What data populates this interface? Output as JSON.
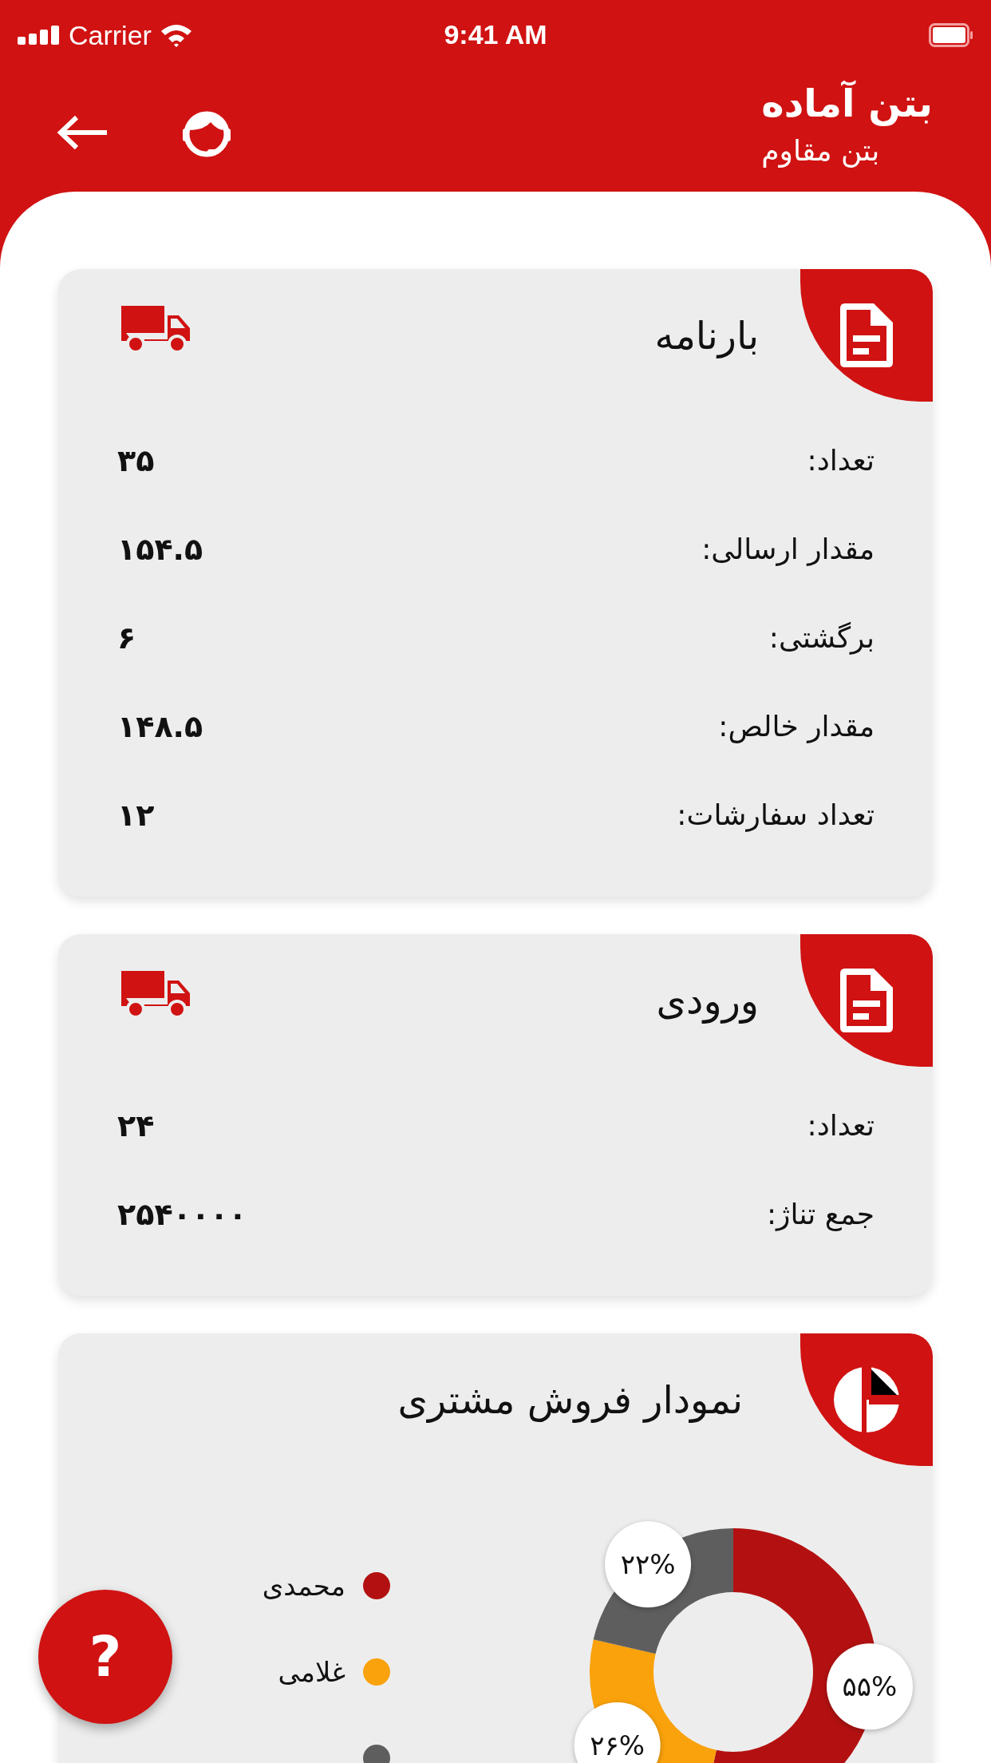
{
  "status_bar": {
    "carrier": "Carrier",
    "time": "9:41 AM"
  },
  "header": {
    "title": "بتن آماده",
    "subtitle": "بتن مقاوم"
  },
  "cards": [
    {
      "title": "بارنامه",
      "rows": [
        {
          "label": "تعداد:",
          "value": "۳۵"
        },
        {
          "label": "مقدار ارسالی:",
          "value": "۱۵۴.۵"
        },
        {
          "label": "برگشتی:",
          "value": "۶"
        },
        {
          "label": "مقدار خالص:",
          "value": "۱۴۸.۵"
        },
        {
          "label": "تعداد سفارشات:",
          "value": "۱۲"
        }
      ]
    },
    {
      "title": "ورودی",
      "rows": [
        {
          "label": "تعداد:",
          "value": "۲۴"
        },
        {
          "label": "جمع تناژ:",
          "value": "۲۵۴۰۰۰۰"
        }
      ]
    }
  ],
  "chart_card": {
    "title": "نمودار فروش مشتری",
    "legend": [
      {
        "label": "محمدی",
        "color": "#b31111"
      },
      {
        "label": "غلامی",
        "color": "#f9a20b"
      },
      {
        "color": "#5e5e5e"
      }
    ],
    "chart_data": {
      "type": "donut",
      "values": [
        55,
        26,
        22
      ],
      "value_labels": [
        "۵۵%",
        "۲۶%",
        "۲۲%"
      ]
    }
  },
  "help_button": {
    "label": "?"
  }
}
